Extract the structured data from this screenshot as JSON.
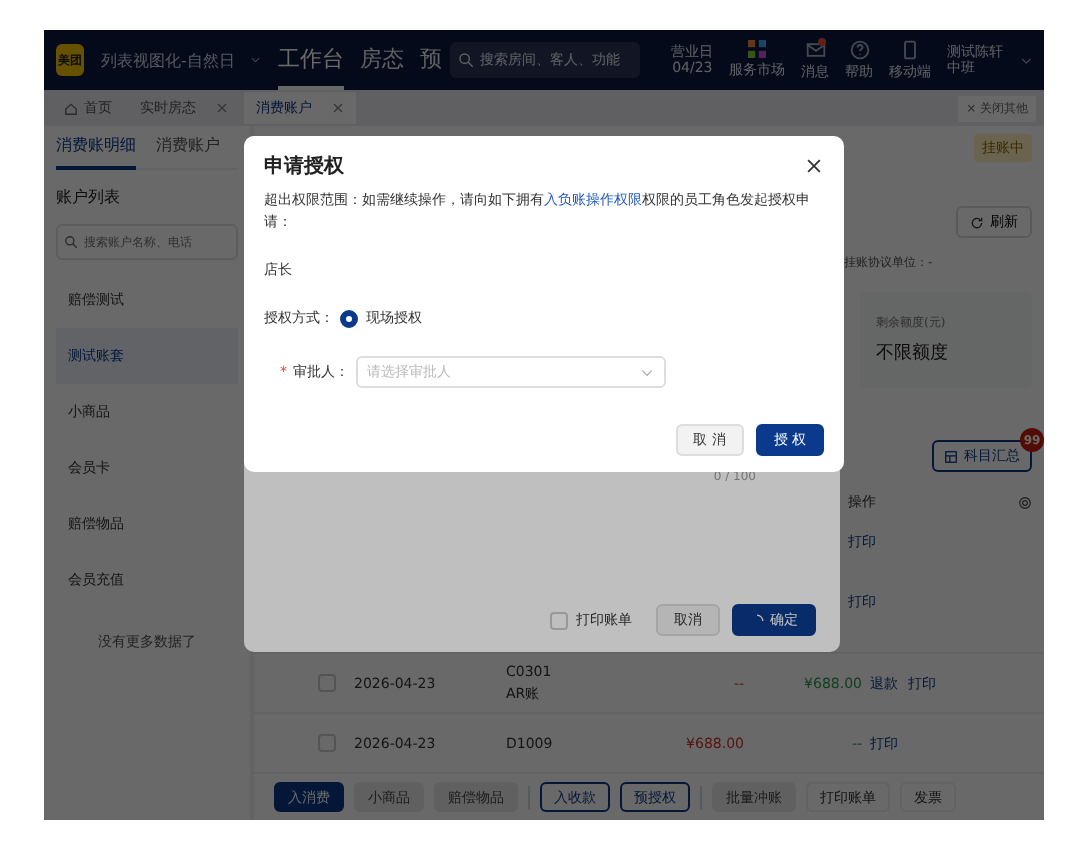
{
  "nav": {
    "brand": "美团",
    "store": "列表视图化-自然日",
    "menu": [
      {
        "label": "工作台",
        "selected": true
      },
      {
        "label": "房态",
        "selected": false
      },
      {
        "label": "预",
        "selected": false
      }
    ],
    "search": {
      "placeholder": "搜索房间、客人、功能"
    },
    "business_day": {
      "label": "营业日",
      "date": "04/23"
    },
    "tools": [
      {
        "kind": "market",
        "label": "服务市场",
        "dot": false
      },
      {
        "kind": "message",
        "label": "消息",
        "dot": true
      },
      {
        "kind": "help",
        "label": "帮助",
        "dot": false
      },
      {
        "kind": "mobile",
        "label": "移动端",
        "dot": false
      }
    ],
    "user": {
      "name": "测试陈轩",
      "shift": "中班"
    }
  },
  "tabs": [
    {
      "label": "首页",
      "kind": "home",
      "closable": false,
      "selected": false
    },
    {
      "label": "实时房态",
      "kind": "page",
      "closable": true,
      "selected": false
    },
    {
      "label": "消费账户",
      "kind": "page",
      "closable": true,
      "selected": true
    }
  ],
  "close_others": "× 关闭其他",
  "sidebar": {
    "subtabs": [
      {
        "label": "消费账明细",
        "selected": true
      },
      {
        "label": "消费账户",
        "selected": false
      }
    ],
    "title": "账户列表",
    "search": {
      "placeholder": "搜索账户名称、电话"
    },
    "items": [
      {
        "label": "赔偿测试",
        "selected": false
      },
      {
        "label": "测试账套",
        "selected": true
      },
      {
        "label": "小商品",
        "selected": false
      },
      {
        "label": "会员卡",
        "selected": false
      },
      {
        "label": "赔偿物品",
        "selected": false
      },
      {
        "label": "会员充值",
        "selected": false
      }
    ],
    "footer": "没有更多数据了"
  },
  "account": {
    "status": "挂账中",
    "refresh": "刷新",
    "protocol": "挂账协议单位：-",
    "quota_label": "剩余额度(元)",
    "quota_value": "不限额度",
    "summary_button": "科目汇总",
    "summary_badge": "99",
    "actions_header": "操作",
    "row_actions": [
      [
        "打印"
      ],
      [
        "打印"
      ]
    ]
  },
  "table": {
    "rows": [
      {
        "checked": false,
        "date": "2026-04-23",
        "code": "C0301",
        "type": "AR账",
        "debit": "--",
        "credit": "¥688.00",
        "actions": [
          "退款",
          "打印"
        ]
      },
      {
        "checked": false,
        "date": "2026-04-23",
        "code": "D1009",
        "debit": "¥688.00",
        "credit": "--",
        "actions": [
          "打印"
        ]
      }
    ]
  },
  "bottom_bar": [
    {
      "label": "入消费",
      "kind": "primary"
    },
    {
      "label": "小商品",
      "kind": "disabled"
    },
    {
      "label": "赔偿物品",
      "kind": "disabled"
    },
    {
      "label": "入收款",
      "kind": "outline"
    },
    {
      "label": "预授权",
      "kind": "outline"
    },
    {
      "label": "批量冲账",
      "kind": "disabled"
    },
    {
      "label": "打印账单",
      "kind": "text"
    },
    {
      "label": "发票",
      "kind": "text"
    }
  ],
  "entry_dialog": {
    "counter": "0 / 100",
    "print_bill": {
      "label": "打印账单",
      "checked": false
    },
    "cancel": "取消",
    "confirm": "确定",
    "loading": true
  },
  "auth_dialog": {
    "title": "申请授权",
    "message": "超出权限范围：如需继续操作，请向如下拥有",
    "permission": "入负账操作权限",
    "message_end": "权限的员工角色发起授权申请：",
    "role": "店长",
    "method_label": "授权方式：",
    "methods": [
      {
        "label": "现场授权",
        "selected": true
      }
    ],
    "approver": {
      "required_mark": "*",
      "label": "审批人：",
      "placeholder": "请选择审批人"
    },
    "cancel": "取 消",
    "submit": "授 权"
  }
}
